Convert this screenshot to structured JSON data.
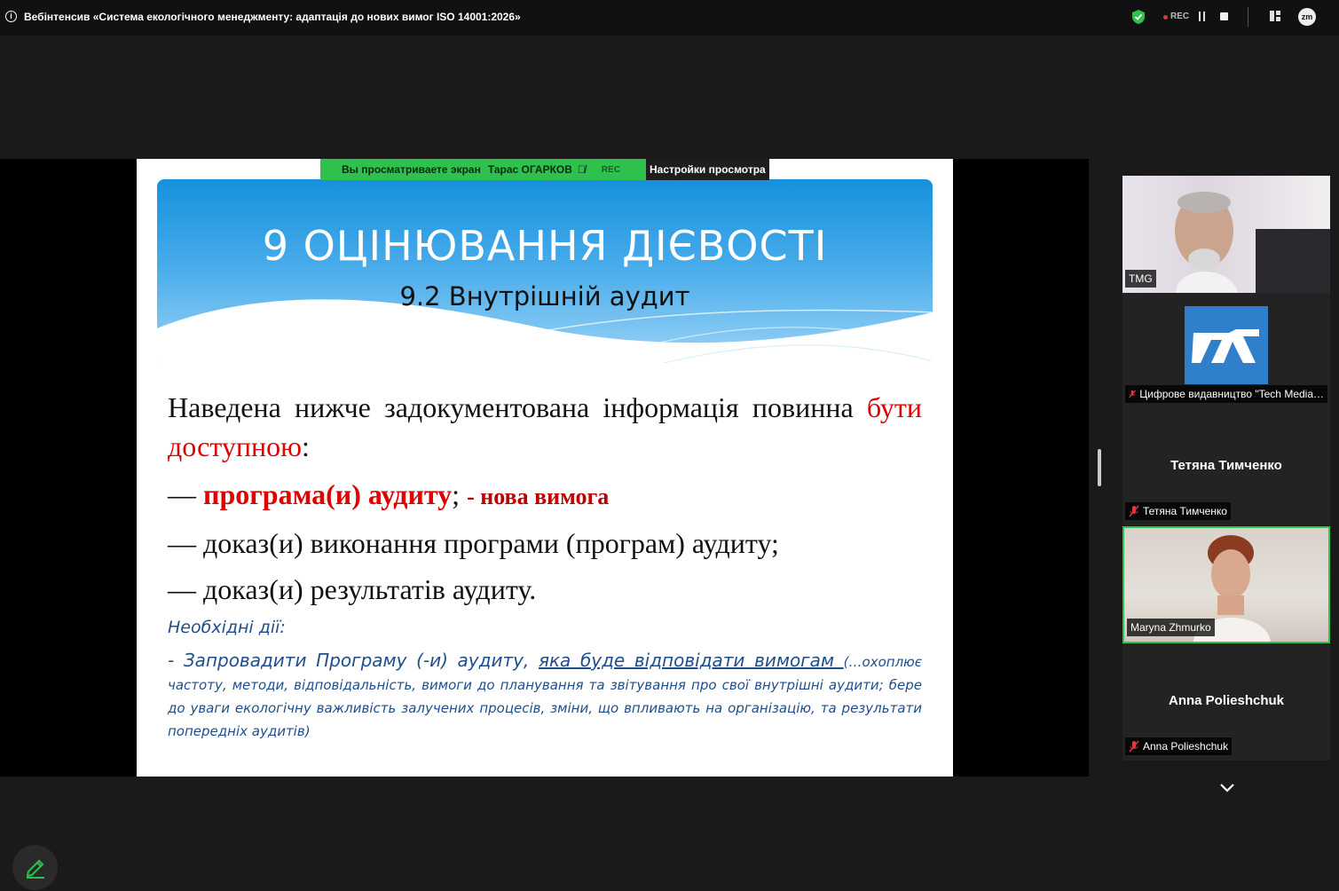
{
  "window": {
    "title": "Вебінтенсив «Система екологічного менеджменту: адаптація до нових вимог ISO 14001:2026»",
    "rec_label": "REC",
    "zoom_logo": "zm"
  },
  "banner": {
    "viewing_text": "Вы просматриваете экран",
    "presenter": "Тарас ОГАРКОВ",
    "rec_label": "REC",
    "settings_label": "Настройки просмотра"
  },
  "slide": {
    "title": "9 ОЦІНЮВАННЯ ДІЄВОСТІ",
    "subtitle": "9.2 Внутрішній аудит",
    "intro_text": "Наведена нижче задокументована інформація повинна ",
    "intro_red": "бути доступною",
    "intro_end": ":",
    "item1_dash": "— ",
    "item1_bold": "програма(и) аудиту",
    "item1_end": "; ",
    "item1_note": " - нова вимога",
    "item2": "— доказ(и) виконання програми (програм) аудиту;",
    "item3": "— доказ(и) результатів аудиту.",
    "actions_title": "Необхідні дії:",
    "actions_lead": "- Запровадити Програму (-и) аудиту, ",
    "actions_underlined": "яка буде відповідати вимогам ",
    "actions_detail": "(…охоплює частоту, методи, відповідальність, вимоги до планування та звітування про свої внутрішні аудити; бере до уваги екологічну важливість залучених процесів, зміни, що впливають на організацію, та результати попередніх аудитів)"
  },
  "participants": [
    {
      "name": "TMG",
      "video": true,
      "muted": false
    },
    {
      "name": "Цифрове видавництво \"Tech Media…",
      "video": false,
      "muted": true,
      "logo": true
    },
    {
      "name": "Тетяна Тимченко",
      "display_name": "Тетяна Тимченко",
      "video": false,
      "muted": true
    },
    {
      "name": "Maryna Zhmurko",
      "video": true,
      "muted": false,
      "active": true
    },
    {
      "name": "Anna Polieshchuk",
      "display_name": "Anna Polieshchuk",
      "video": false,
      "muted": true
    }
  ],
  "colors": {
    "accent_green": "#2ec14e",
    "slide_red": "#e00000",
    "slide_blue_text": "#1f4e8c",
    "header_blue": "#1691dd"
  }
}
